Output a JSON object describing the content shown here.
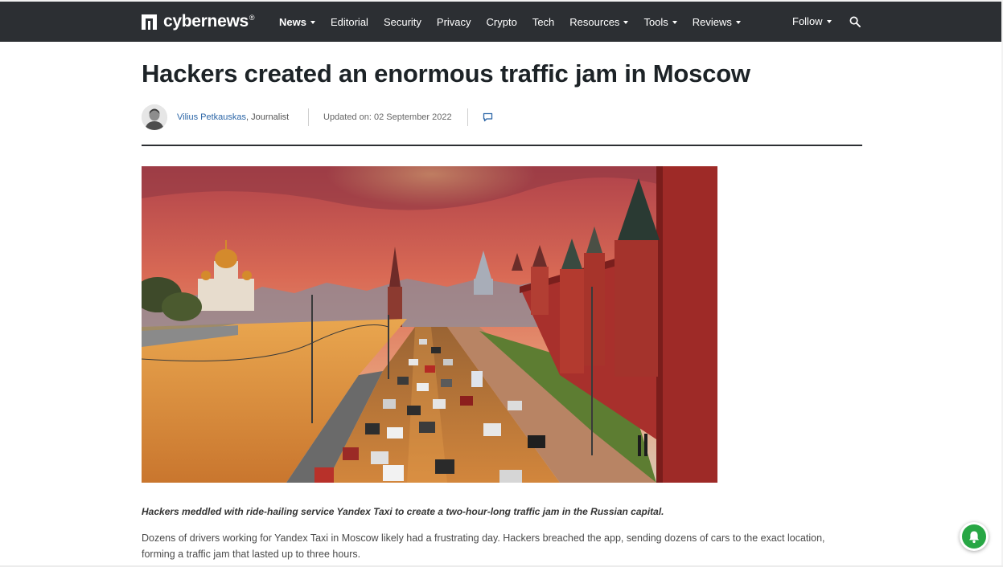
{
  "nav": {
    "logo_text": "cybernews",
    "logo_reg": "®",
    "items": [
      {
        "label": "News",
        "dropdown": true,
        "bold": true
      },
      {
        "label": "Editorial",
        "dropdown": false,
        "bold": false
      },
      {
        "label": "Security",
        "dropdown": false,
        "bold": false
      },
      {
        "label": "Privacy",
        "dropdown": false,
        "bold": false
      },
      {
        "label": "Crypto",
        "dropdown": false,
        "bold": false
      },
      {
        "label": "Tech",
        "dropdown": false,
        "bold": false
      },
      {
        "label": "Resources",
        "dropdown": true,
        "bold": false
      },
      {
        "label": "Tools",
        "dropdown": true,
        "bold": false
      },
      {
        "label": "Reviews",
        "dropdown": true,
        "bold": false
      }
    ],
    "follow_label": "Follow",
    "search_icon": "search-icon"
  },
  "article": {
    "headline": "Hackers created an enormous traffic jam in Moscow",
    "author_name": "Vilius Petkauskas",
    "author_role": ", Journalist",
    "updated": "Updated on: 02 September 2022",
    "comment_icon": "comment-icon",
    "lede": "Hackers meddled with ride-hailing service Yandex Taxi to create a two-hour-long traffic jam in the Russian capital.",
    "body": "Dozens of drivers working for Yandex Taxi in Moscow likely had a frustrating day. Hackers breached the app, sending dozens of cars to the exact location, forming a traffic jam that lasted up to three hours."
  },
  "colors": {
    "nav_bg": "#2c2f33",
    "link": "#2c66a7",
    "bell_green": "#28a745"
  },
  "widgets": {
    "bell_icon": "bell-icon"
  }
}
